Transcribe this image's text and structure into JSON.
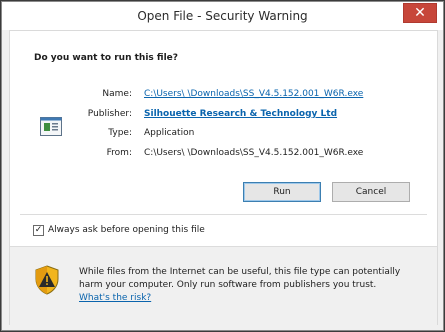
{
  "window": {
    "title": "Open File - Security Warning",
    "close_glyph": "✕"
  },
  "prompt": {
    "question": "Do you want to run this file?"
  },
  "details": {
    "name_label": "Name:",
    "name_value": "C:\\Users\\          \\Downloads\\SS_V4.5.152.001_W6R.exe",
    "publisher_label": "Publisher:",
    "publisher_value": "Silhouette Research & Technology Ltd",
    "type_label": "Type:",
    "type_value": "Application",
    "from_label": "From:",
    "from_value": "C:\\Users\\          \\Downloads\\SS_V4.5.152.001_W6R.exe",
    "file_icon": "application-icon"
  },
  "buttons": {
    "run": "Run",
    "cancel": "Cancel"
  },
  "checkbox": {
    "label": "Always ask before opening this file",
    "checked": true,
    "check_glyph": "✓"
  },
  "warning": {
    "icon": "shield-icon",
    "text": "While files from the Internet can be useful, this file type can potentially harm your computer. Only run software from publishers you trust.",
    "link": "What's the risk?"
  },
  "colors": {
    "link": "#0a64ad",
    "close": "#c7463a",
    "accent_border": "#3c7fb1"
  }
}
